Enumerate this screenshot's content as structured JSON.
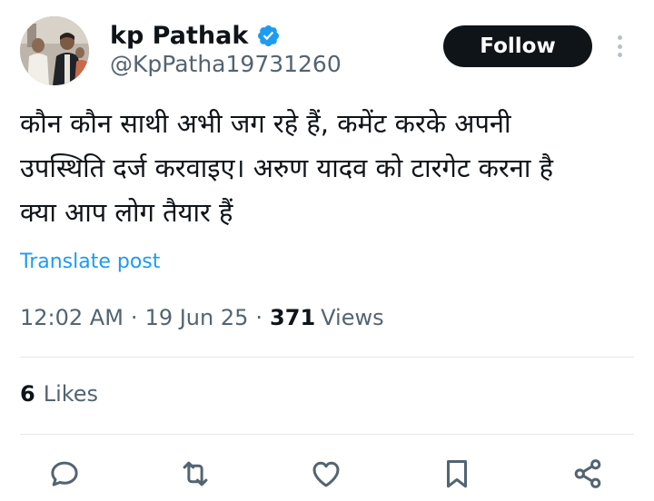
{
  "author": {
    "display_name": "kp Pathak",
    "handle": "@KpPatha19731260",
    "verified_icon": "verified-badge-icon",
    "avatar": "user-avatar-photo"
  },
  "follow_button": {
    "label": "Follow"
  },
  "more_menu": {
    "icon": "more-vertical-icon"
  },
  "tweet": {
    "text": "कौन कौन साथी अभी जग रहे हैं, कमेंट करके अपनी\nउपस्थिति दर्ज करवाइए। अरुण यादव को टारगेट करना है\nक्या आप लोग तैयार हैं",
    "translate_label": "Translate post",
    "time": "12:02 AM",
    "separator": "·",
    "date": "19 Jun 25",
    "views_count": "371",
    "views_label": "Views",
    "likes_count": "6",
    "likes_label": "Likes"
  },
  "actions": [
    {
      "name": "reply",
      "icon": "reply-icon"
    },
    {
      "name": "repost",
      "icon": "repost-icon"
    },
    {
      "name": "like",
      "icon": "like-heart-icon"
    },
    {
      "name": "bookmark",
      "icon": "bookmark-icon"
    },
    {
      "name": "share",
      "icon": "share-icon"
    }
  ],
  "colors": {
    "text": "#0f1419",
    "secondary_text": "#536471",
    "link": "#1d9bf0",
    "button_bg": "#0f1419",
    "divider": "#e4e8ea"
  }
}
